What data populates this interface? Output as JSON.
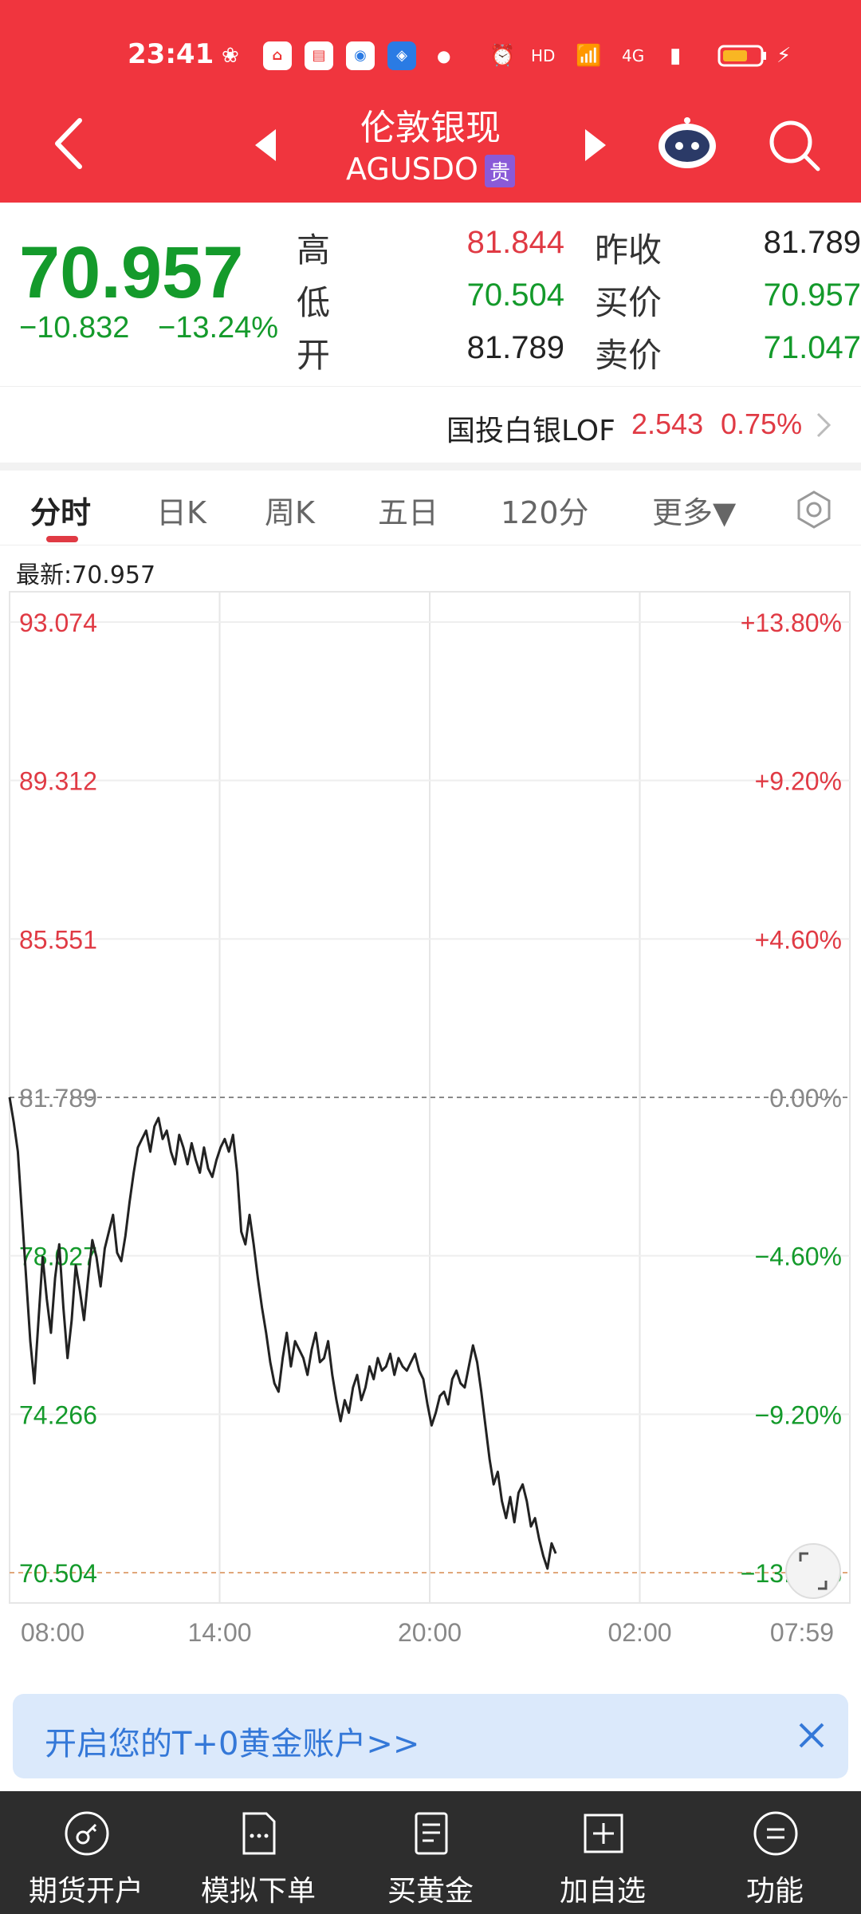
{
  "status_bar": {
    "time": "23:41",
    "network": "4G"
  },
  "header": {
    "title": "伦敦银现",
    "code": "AGUSDO",
    "tag": "贵"
  },
  "quote": {
    "price": "70.957",
    "change": "−10.832",
    "change_pct": "−13.24%",
    "rows": [
      {
        "label1": "高",
        "value1": "81.844",
        "label2": "昨收",
        "value2": "81.789"
      },
      {
        "label1": "低",
        "value1": "70.504",
        "label2": "买价",
        "value2": "70.957"
      },
      {
        "label1": "开",
        "value1": "81.789",
        "label2": "卖价",
        "value2": "71.047"
      }
    ]
  },
  "related": {
    "name": "国投白银LOF",
    "value": "2.543",
    "pct": "0.75%"
  },
  "tabs": [
    {
      "label": "分时",
      "active": true
    },
    {
      "label": "日K",
      "active": false
    },
    {
      "label": "周K",
      "active": false
    },
    {
      "label": "五日",
      "active": false
    },
    {
      "label": "120分",
      "active": false
    },
    {
      "label": "更多▼",
      "active": false
    }
  ],
  "latest_label": "最新:70.957",
  "chart_data": {
    "type": "line",
    "prev_close": 81.789,
    "ylim": [
      70.504,
      93.074
    ],
    "y_left_labels": [
      "93.074",
      "89.312",
      "85.551",
      "81.789",
      "78.027",
      "74.266",
      "70.504"
    ],
    "y_right_labels": [
      "+13.80%",
      "+9.20%",
      "+4.60%",
      "0.00%",
      "−4.60%",
      "−9.20%",
      "−13.80%"
    ],
    "x_labels": [
      "08:00",
      "14:00",
      "20:00",
      "02:00",
      "07:59"
    ],
    "series": [
      {
        "values": [
          81.79,
          81.2,
          80.5,
          79.0,
          77.5,
          76.0,
          75.0,
          76.5,
          78.0,
          77.0,
          76.2,
          77.5,
          78.3,
          76.8,
          75.6,
          76.5,
          77.8,
          77.2,
          76.5,
          77.5,
          78.4,
          78.0,
          77.3,
          78.2,
          78.6,
          79.0,
          78.1,
          77.9,
          78.5,
          79.3,
          80.0,
          80.6,
          80.8,
          81.0,
          80.5,
          81.1,
          81.3,
          80.8,
          81.0,
          80.5,
          80.2,
          80.9,
          80.6,
          80.2,
          80.7,
          80.3,
          80.0,
          80.6,
          80.1,
          79.9,
          80.3,
          80.6,
          80.8,
          80.5,
          80.9,
          80.0,
          78.6,
          78.3,
          79.0,
          78.3,
          77.5,
          76.8,
          76.2,
          75.5,
          75.0,
          74.8,
          75.6,
          76.2,
          75.4,
          76.0,
          75.8,
          75.6,
          75.2,
          75.8,
          76.2,
          75.5,
          75.6,
          76.0,
          75.2,
          74.6,
          74.1,
          74.6,
          74.3,
          74.9,
          75.2,
          74.6,
          74.9,
          75.4,
          75.1,
          75.6,
          75.3,
          75.4,
          75.7,
          75.2,
          75.6,
          75.4,
          75.3,
          75.5,
          75.7,
          75.3,
          75.1,
          74.5,
          74.0,
          74.3,
          74.7,
          74.8,
          74.5,
          75.1,
          75.3,
          75.0,
          74.9,
          75.4,
          75.9,
          75.5,
          74.8,
          74.0,
          73.2,
          72.6,
          72.9,
          72.2,
          71.8,
          72.3,
          71.7,
          72.4,
          72.6,
          72.2,
          71.6,
          71.8,
          71.3,
          70.9,
          70.6,
          71.2,
          70.96
        ]
      }
    ]
  },
  "banner": {
    "text": "开启您的T+0黄金账户>>"
  },
  "bottom_nav": [
    {
      "label": "期货开户",
      "icon": "key-icon"
    },
    {
      "label": "模拟下单",
      "icon": "document-dots-icon"
    },
    {
      "label": "买黄金",
      "icon": "list-icon"
    },
    {
      "label": "加自选",
      "icon": "plus-box-icon"
    },
    {
      "label": "功能",
      "icon": "menu-circle-icon"
    }
  ]
}
